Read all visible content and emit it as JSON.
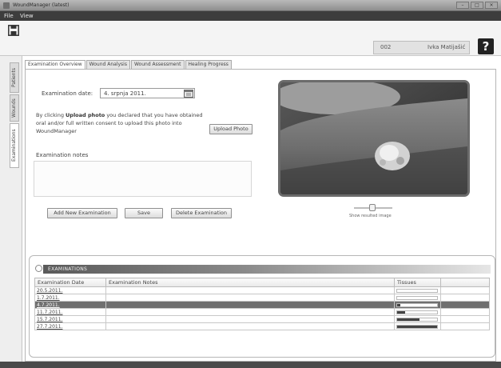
{
  "window": {
    "title": "WoundManager (latest)"
  },
  "menu": [
    "File",
    "View"
  ],
  "header": {
    "patient_id": "002",
    "patient_name": "Ivka Matijašić",
    "help_label": "?"
  },
  "sidebar": {
    "tabs": [
      "Patients",
      "Wounds",
      "Examinations"
    ]
  },
  "tabs": [
    "Examination Overview",
    "Wound Analysis",
    "Wound Assessment",
    "Healing Progress"
  ],
  "overview": {
    "date_label": "Examination date:",
    "date_value": "4. srpnja 2011.",
    "consent_prefix": "By clicking ",
    "consent_bold": "Upload photo",
    "consent_suffix": " you declared that you have obtained oral and/or full written consent to upload this photo into WoundManager",
    "upload_label": "Upload Photo",
    "notes_label": "Examination notes",
    "notes_value": "",
    "add_label": "Add New Examination",
    "save_label": "Save",
    "delete_label": "Delete Examination",
    "slider_caption": "Show resulted image"
  },
  "examinations": {
    "title": "EXAMINATIONS",
    "columns": [
      "Examination Date",
      "Examination Notes",
      "Tissues"
    ],
    "rows": [
      {
        "date": "20.5.2011.",
        "notes": "",
        "tissue": 0.0,
        "selected": false
      },
      {
        "date": "1.7.2011.",
        "notes": "",
        "tissue": 0.0,
        "selected": false
      },
      {
        "date": "4.7.2011.",
        "notes": "",
        "tissue": 0.08,
        "selected": true
      },
      {
        "date": "11.7.2011.",
        "notes": "",
        "tissue": 0.2,
        "selected": false
      },
      {
        "date": "15.7.2011.",
        "notes": "",
        "tissue": 0.55,
        "selected": false
      },
      {
        "date": "27.7.2011.",
        "notes": "",
        "tissue": 1.0,
        "selected": false
      }
    ]
  },
  "colors": {
    "menubar": "#3d3d3d",
    "selected_row": "#6f6f6f",
    "accent": "#222222"
  }
}
